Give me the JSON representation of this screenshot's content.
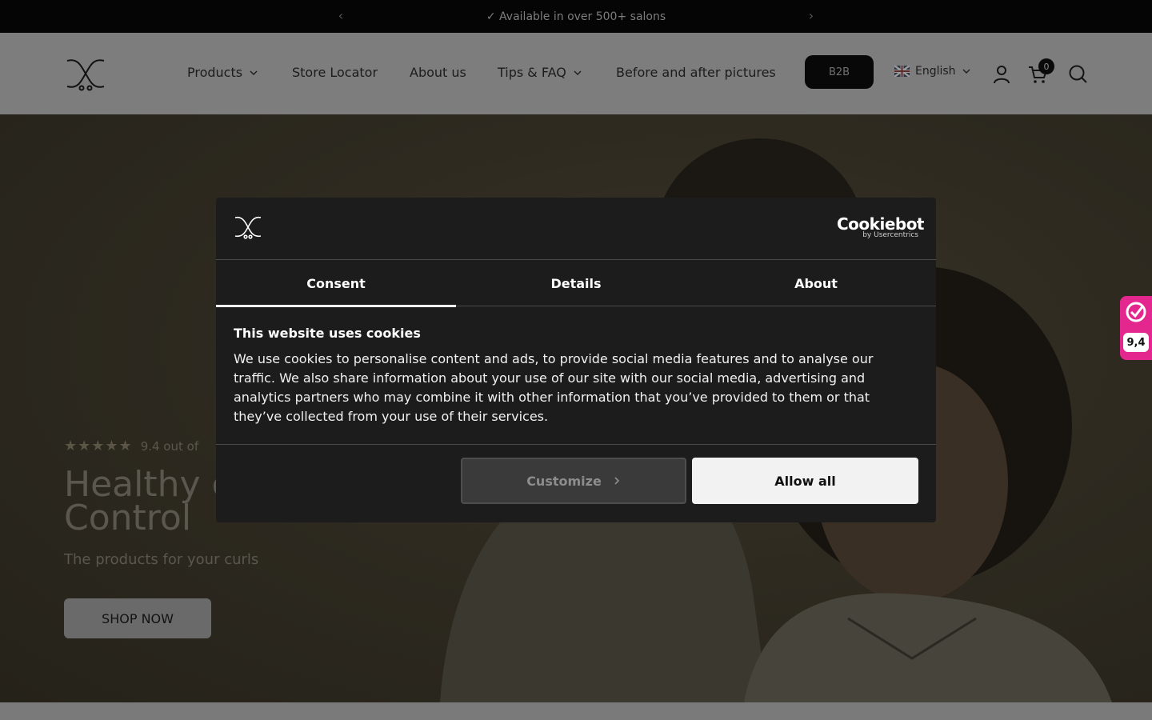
{
  "announcement": {
    "text": "✓ Available in over 500+ salons"
  },
  "header": {
    "nav": [
      {
        "label": "Products"
      },
      {
        "label": "Store Locator"
      },
      {
        "label": "About us"
      },
      {
        "label": "Tips & FAQ"
      },
      {
        "label": "Before and after pictures"
      }
    ],
    "b2b_label": "B2B",
    "language": "English",
    "cart_count": "0"
  },
  "hero": {
    "stars": "★★★★★",
    "rating_text": "9.4 out of",
    "title": "Healthy c with Curls Control",
    "subtitle": "The products for your curls",
    "cta": "SHOP NOW"
  },
  "side_widget": {
    "score": "9,4"
  },
  "cookie_dialog": {
    "brand": "Cookiebot",
    "brand_sub": "by Usercentrics",
    "tabs": [
      {
        "label": "Consent"
      },
      {
        "label": "Details"
      },
      {
        "label": "About"
      }
    ],
    "heading": "This website uses cookies",
    "body": "We use cookies to personalise content and ads, to provide social media features and to analyse our traffic. We also share information about your use of our site with our social media, advertising and analytics partners who may combine it with other information that you’ve provided to them or that they’ve collected from your use of their services.",
    "customize_label": "Customize",
    "allow_label": "Allow all"
  }
}
